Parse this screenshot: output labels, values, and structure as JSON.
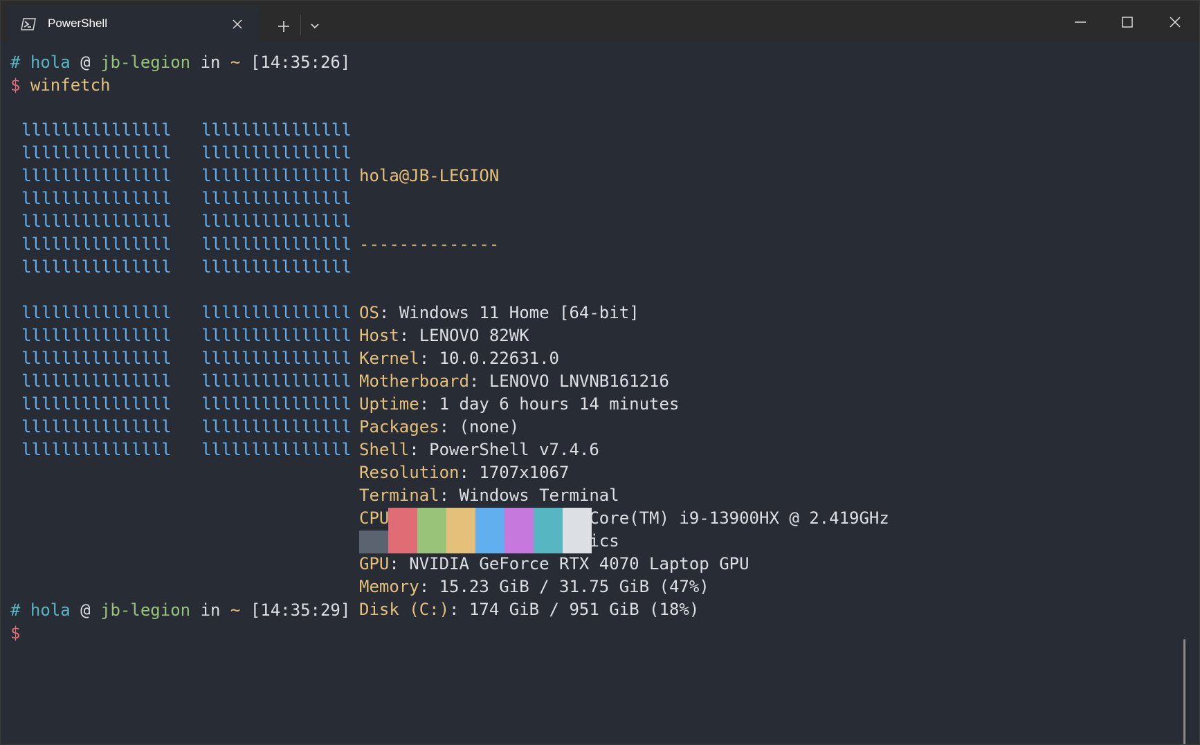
{
  "colors": {
    "cyan": "#56b6c2",
    "green": "#98c379",
    "red": "#e06c75",
    "yellow": "#e5c07b",
    "blue": "#61afef",
    "foreground": "#dcdfe4",
    "background": "#282c34"
  },
  "titlebar": {
    "tab_icon": "powershell-icon",
    "tab_title": "PowerShell",
    "close_icon": "close-icon",
    "new_tab_icon": "plus-icon",
    "dropdown_icon": "chevron-down-icon",
    "minimize_icon": "minimize-icon",
    "maximize_icon": "maximize-icon",
    "window_close_icon": "close-icon"
  },
  "prompt1": {
    "hash": "#",
    "user": "hola",
    "at": "@",
    "host": "jb-legion",
    "in": "in",
    "path": "~",
    "time": "[14:35:26]",
    "dollar": "$",
    "command": "winfetch"
  },
  "logo": {
    "block": "lllllllllllllll",
    "rows": [
      "lllllllllllllll   lllllllllllllll",
      "lllllllllllllll   lllllllllllllll",
      "lllllllllllllll   lllllllllllllll",
      "lllllllllllllll   lllllllllllllll",
      "lllllllllllllll   lllllllllllllll",
      "lllllllllllllll   lllllllllllllll",
      "lllllllllllllll   lllllllllllllll",
      "",
      "lllllllllllllll   lllllllllllllll",
      "lllllllllllllll   lllllllllllllll",
      "lllllllllllllll   lllllllllllllll",
      "lllllllllllllll   lllllllllllllll",
      "lllllllllllllll   lllllllllllllll",
      "lllllllllllllll   lllllllllllllll",
      "lllllllllllllll   lllllllllllllll"
    ]
  },
  "info": {
    "header": "hola@JB-LEGION",
    "separator": "--------------",
    "fields": [
      {
        "key": "OS",
        "value": "Windows 11 Home [64-bit]"
      },
      {
        "key": "Host",
        "value": "LENOVO 82WK"
      },
      {
        "key": "Kernel",
        "value": "10.0.22631.0"
      },
      {
        "key": "Motherboard",
        "value": "LENOVO LNVNB161216"
      },
      {
        "key": "Uptime",
        "value": "1 day 6 hours 14 minutes"
      },
      {
        "key": "Packages",
        "value": "(none)"
      },
      {
        "key": "Shell",
        "value": "PowerShell v7.4.6"
      },
      {
        "key": "Resolution",
        "value": "1707x1067"
      },
      {
        "key": "Terminal",
        "value": "Windows Terminal"
      },
      {
        "key": "CPU",
        "value": "13th Gen Intel(R) Core(TM) i9-13900HX @ 2.419GHz"
      },
      {
        "key": "GPU",
        "value": "Intel(R) UHD Graphics"
      },
      {
        "key": "GPU",
        "value": "NVIDIA GeForce RTX 4070 Laptop GPU"
      },
      {
        "key": "Memory",
        "value": "15.23 GiB / 31.75 GiB (47%)"
      },
      {
        "key": "Disk (C:)",
        "value": "174 GiB / 951 GiB (18%)"
      }
    ],
    "separator_char": ": "
  },
  "palette": [
    "#5c6370",
    "#e06c75",
    "#98c379",
    "#e5c07b",
    "#61afef",
    "#c678dd",
    "#56b6c2",
    "#dcdfe4"
  ],
  "prompt2": {
    "hash": "#",
    "user": "hola",
    "at": "@",
    "host": "jb-legion",
    "in": "in",
    "path": "~",
    "time": "[14:35:29]",
    "dollar": "$"
  }
}
